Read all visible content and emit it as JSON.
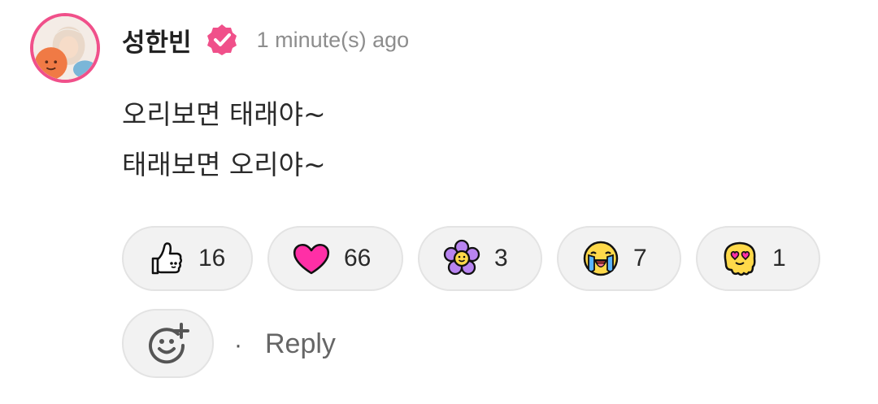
{
  "author": {
    "name": "성한빈",
    "verified_icon": "verified-badge-icon",
    "timestamp": "1 minute(s) ago"
  },
  "comment": {
    "lines": [
      "오리보면 태래야~",
      "태래보면 오리야~"
    ]
  },
  "reactions": [
    {
      "icon": "thumbs-up-icon",
      "count": "16"
    },
    {
      "icon": "heart-icon",
      "count": "66"
    },
    {
      "icon": "flower-icon",
      "count": "3"
    },
    {
      "icon": "crying-face-icon",
      "count": "7"
    },
    {
      "icon": "heart-eyes-melting-icon",
      "count": "1"
    }
  ],
  "actions": {
    "add_reaction_icon": "add-reaction-icon",
    "separator": "·",
    "reply_label": "Reply"
  },
  "colors": {
    "accent": "#f0508a",
    "heart": "#ff2fa6",
    "timestamp": "#8d8d8d"
  }
}
